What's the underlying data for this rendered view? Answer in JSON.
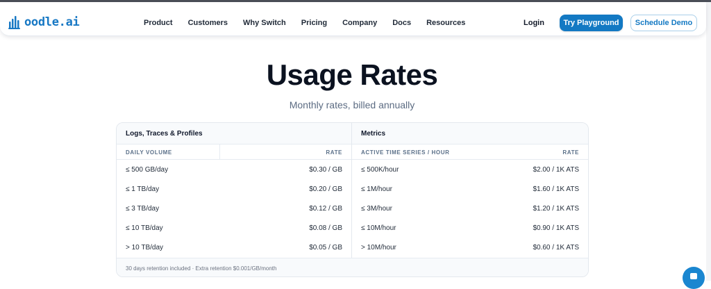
{
  "nav": {
    "logo": "oodle.ai",
    "links": [
      "Product",
      "Customers",
      "Why Switch",
      "Pricing",
      "Company",
      "Docs",
      "Resources"
    ],
    "login": "Login",
    "primary_cta": "Try Playground",
    "secondary_cta": "Schedule Demo"
  },
  "hero": {
    "title": "Usage Rates",
    "subtitle": "Monthly rates, billed annually"
  },
  "pricing": {
    "logs": {
      "title": "Logs, Traces & Profiles",
      "col1": "DAILY VOLUME",
      "col2": "RATE",
      "rows": [
        {
          "tier": "≤ 500 GB/day",
          "rate": "$0.30 / GB"
        },
        {
          "tier": "≤ 1 TB/day",
          "rate": "$0.20 / GB"
        },
        {
          "tier": "≤ 3 TB/day",
          "rate": "$0.12 / GB"
        },
        {
          "tier": "≤ 10 TB/day",
          "rate": "$0.08 / GB"
        },
        {
          "tier": "> 10 TB/day",
          "rate": "$0.05 / GB"
        }
      ]
    },
    "metrics": {
      "title": "Metrics",
      "col1": "ACTIVE TIME SERIES / HOUR",
      "col2": "RATE",
      "rows": [
        {
          "tier": "≤ 500K/hour",
          "rate": "$2.00 / 1K ATS"
        },
        {
          "tier": "≤ 1M/hour",
          "rate": "$1.60 / 1K ATS"
        },
        {
          "tier": "≤ 3M/hour",
          "rate": "$1.20 / 1K ATS"
        },
        {
          "tier": "≤ 10M/hour",
          "rate": "$0.90 / 1K ATS"
        },
        {
          "tier": "> 10M/hour",
          "rate": "$0.60 / 1K ATS"
        }
      ]
    },
    "footnote": "30 days retention included · Extra retention $0.001/GB/month"
  },
  "colors": {
    "brand": "#1379c3",
    "title": "#0b1220",
    "muted": "#5b6b82"
  }
}
